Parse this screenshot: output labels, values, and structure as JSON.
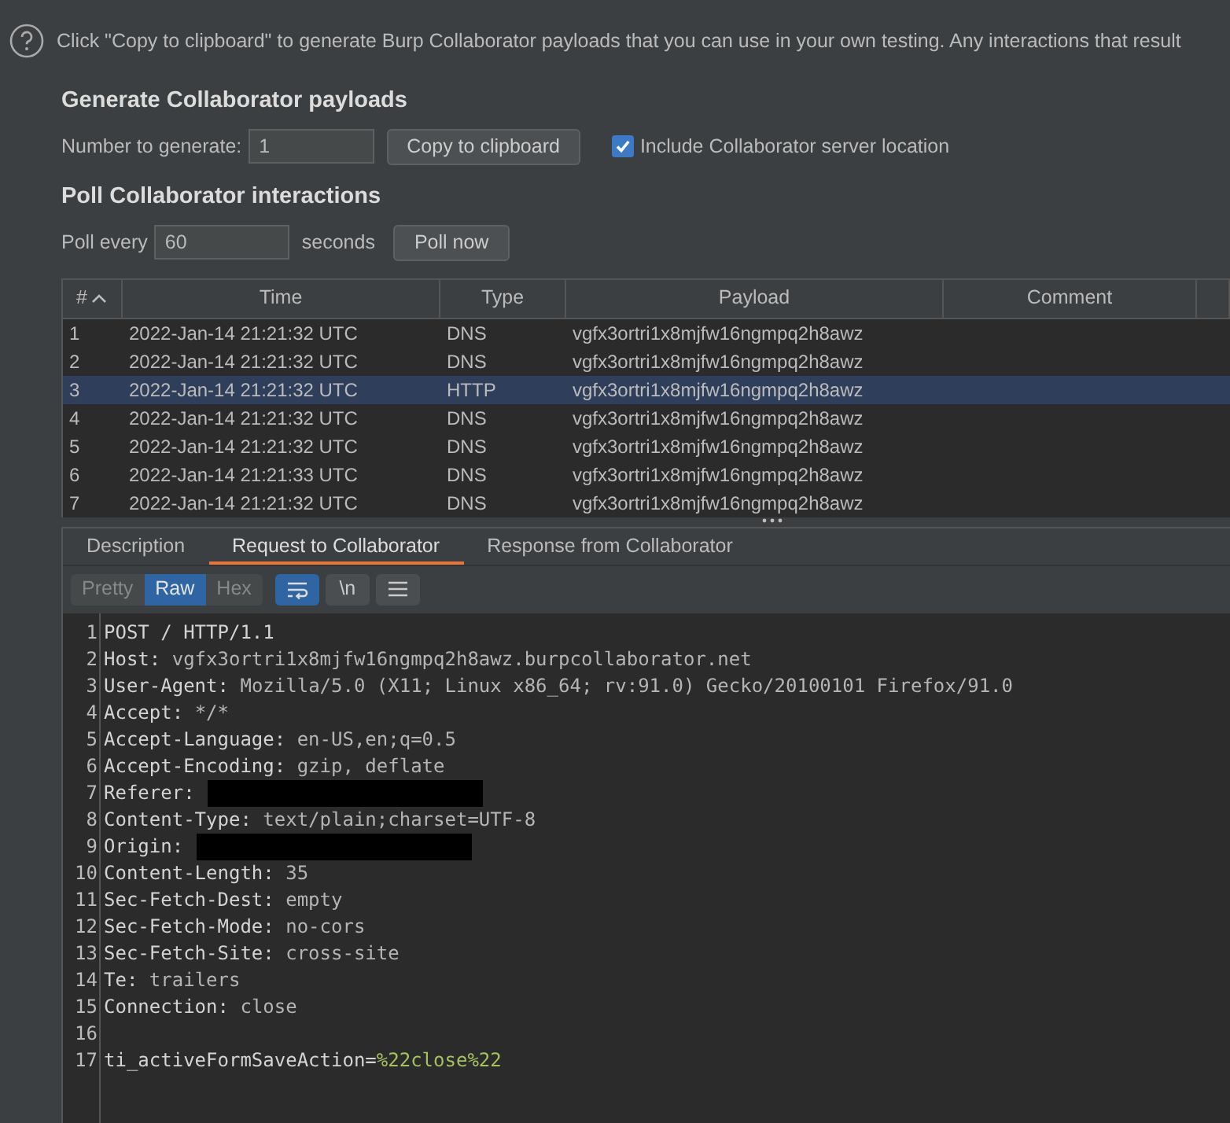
{
  "help_text": "Click \"Copy to clipboard\" to generate Burp Collaborator payloads that you can use in your own testing. Any interactions that result",
  "generate": {
    "heading": "Generate Collaborator payloads",
    "number_label": "Number to generate:",
    "number_value": "1",
    "copy_button": "Copy to clipboard",
    "include_location": {
      "label": "Include Collaborator server location",
      "checked": true
    }
  },
  "poll": {
    "heading": "Poll Collaborator interactions",
    "label": "Poll every",
    "value": "60",
    "unit": "seconds",
    "button": "Poll now"
  },
  "table": {
    "columns": [
      {
        "label": "#",
        "sorted": true
      },
      {
        "label": "Time",
        "sorted": false
      },
      {
        "label": "Type",
        "sorted": false
      },
      {
        "label": "Payload",
        "sorted": false
      },
      {
        "label": "Comment",
        "sorted": false
      }
    ],
    "rows": [
      {
        "cells": [
          "1",
          "2022-Jan-14 21:21:32 UTC",
          "DNS",
          "vgfx3ortri1x8mjfw16ngmpq2h8awz",
          ""
        ],
        "selected": false
      },
      {
        "cells": [
          "2",
          "2022-Jan-14 21:21:32 UTC",
          "DNS",
          "vgfx3ortri1x8mjfw16ngmpq2h8awz",
          ""
        ],
        "selected": false
      },
      {
        "cells": [
          "3",
          "2022-Jan-14 21:21:32 UTC",
          "HTTP",
          "vgfx3ortri1x8mjfw16ngmpq2h8awz",
          ""
        ],
        "selected": true
      },
      {
        "cells": [
          "4",
          "2022-Jan-14 21:21:32 UTC",
          "DNS",
          "vgfx3ortri1x8mjfw16ngmpq2h8awz",
          ""
        ],
        "selected": false
      },
      {
        "cells": [
          "5",
          "2022-Jan-14 21:21:32 UTC",
          "DNS",
          "vgfx3ortri1x8mjfw16ngmpq2h8awz",
          ""
        ],
        "selected": false
      },
      {
        "cells": [
          "6",
          "2022-Jan-14 21:21:33 UTC",
          "DNS",
          "vgfx3ortri1x8mjfw16ngmpq2h8awz",
          ""
        ],
        "selected": false
      },
      {
        "cells": [
          "7",
          "2022-Jan-14 21:21:32 UTC",
          "DNS",
          "vgfx3ortri1x8mjfw16ngmpq2h8awz",
          ""
        ],
        "selected": false
      }
    ]
  },
  "detail_tabs": [
    {
      "label": "Description",
      "selected": false
    },
    {
      "label": "Request to Collaborator",
      "selected": true
    },
    {
      "label": "Response from Collaborator",
      "selected": false
    }
  ],
  "view_modes": [
    {
      "label": "Pretty",
      "selected": false
    },
    {
      "label": "Raw",
      "selected": true
    },
    {
      "label": "Hex",
      "selected": false
    }
  ],
  "toolbar": [
    {
      "kind": "wrap",
      "on": true
    },
    {
      "kind": "newline",
      "label": "\\n",
      "on": false
    },
    {
      "kind": "menu",
      "on": false
    }
  ],
  "request_lines": [
    {
      "kind": "plain",
      "number": "1",
      "text": "POST / HTTP/1.1"
    },
    {
      "kind": "header",
      "number": "2",
      "name": "Host:",
      "value": "vgfx3ortri1x8mjfw16ngmpq2h8awz.burpcollaborator.net"
    },
    {
      "kind": "header",
      "number": "3",
      "name": "User-Agent:",
      "value": "Mozilla/5.0 (X11; Linux x86_64; rv:91.0) Gecko/20100101 Firefox/91.0"
    },
    {
      "kind": "header",
      "number": "4",
      "name": "Accept:",
      "value": "*/*"
    },
    {
      "kind": "header",
      "number": "5",
      "name": "Accept-Language:",
      "value": "en-US,en;q=0.5"
    },
    {
      "kind": "header",
      "number": "6",
      "name": "Accept-Encoding:",
      "value": "gzip, deflate"
    },
    {
      "kind": "redacted",
      "number": "7",
      "name": "Referer:"
    },
    {
      "kind": "header",
      "number": "8",
      "name": "Content-Type:",
      "value": "text/plain;charset=UTF-8"
    },
    {
      "kind": "redacted",
      "number": "9",
      "name": "Origin:"
    },
    {
      "kind": "header",
      "number": "10",
      "name": "Content-Length:",
      "value": "35"
    },
    {
      "kind": "header",
      "number": "11",
      "name": "Sec-Fetch-Dest:",
      "value": "empty"
    },
    {
      "kind": "header",
      "number": "12",
      "name": "Sec-Fetch-Mode:",
      "value": "no-cors"
    },
    {
      "kind": "header",
      "number": "13",
      "name": "Sec-Fetch-Site:",
      "value": "cross-site"
    },
    {
      "kind": "header",
      "number": "14",
      "name": "Te:",
      "value": "trailers"
    },
    {
      "kind": "header",
      "number": "15",
      "name": "Connection:",
      "value": "close"
    },
    {
      "kind": "blank",
      "number": "16"
    },
    {
      "kind": "param",
      "number": "17",
      "name": "ti_activeFormSaveAction=",
      "value": "%22close%22"
    }
  ]
}
